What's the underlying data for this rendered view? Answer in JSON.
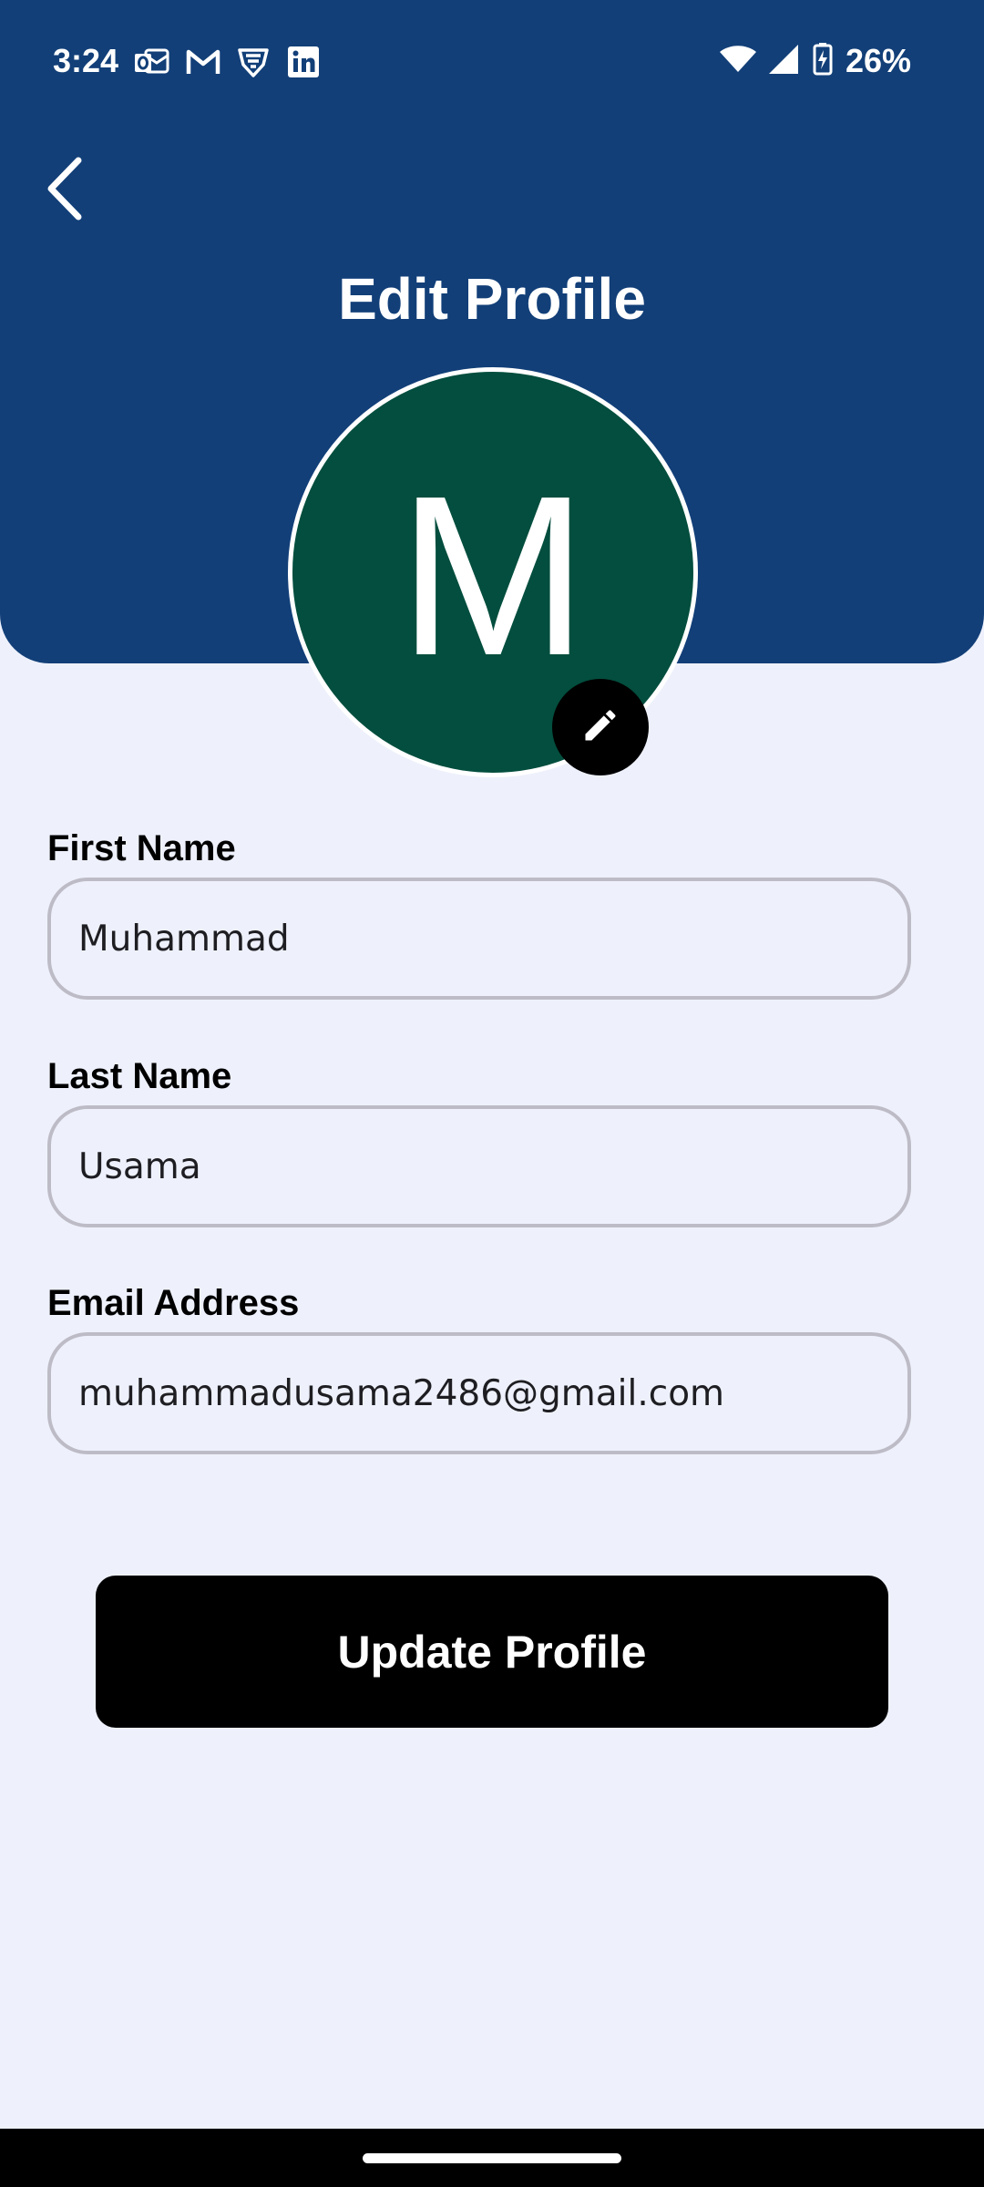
{
  "status_bar": {
    "time": "3:24",
    "battery_percent": "26%",
    "notification_icons": [
      "outlook-icon",
      "gmail-icon",
      "vpn-shield-icon",
      "linkedin-icon"
    ],
    "system_icons": [
      "wifi-icon",
      "cell-signal-icon",
      "battery-charging-icon"
    ]
  },
  "header": {
    "back_icon": "chevron-left-icon",
    "title": "Edit Profile",
    "background_color": "#123f78"
  },
  "avatar": {
    "initial": "M",
    "background_color": "#034e3e",
    "edit_icon": "pencil-icon"
  },
  "form": {
    "first_name": {
      "label": "First Name",
      "value": "Muhammad"
    },
    "last_name": {
      "label": "Last Name",
      "value": "Usama"
    },
    "email": {
      "label": "Email Address",
      "value": "muhammadusama2486@gmail.com"
    }
  },
  "actions": {
    "update_label": "Update Profile"
  },
  "colors": {
    "page_background": "#eef1fc",
    "button_background": "#000000",
    "input_border": "#bdbcc6"
  }
}
